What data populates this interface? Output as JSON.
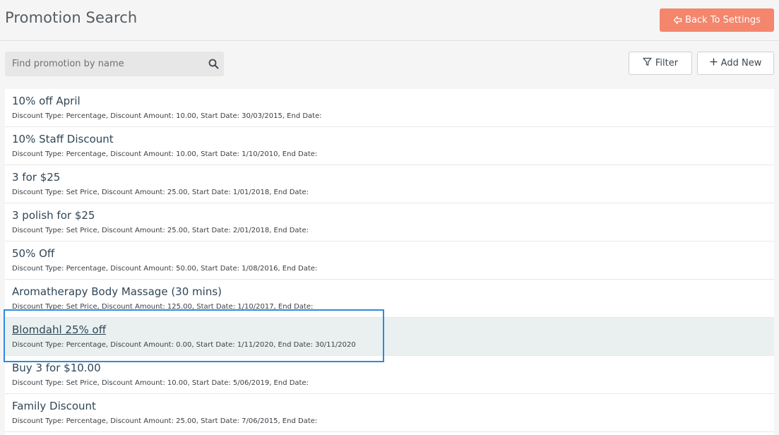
{
  "header": {
    "title": "Promotion Search",
    "back_label": "Back To Settings"
  },
  "toolbar": {
    "search_placeholder": "Find promotion by name",
    "search_value": "",
    "filter_label": "Filter",
    "add_label": "Add New"
  },
  "promotions": [
    {
      "name": "10% off April",
      "details": "Discount Type: Percentage, Discount Amount: 10.00, Start Date: 30/03/2015, End Date:"
    },
    {
      "name": "10% Staff Discount",
      "details": "Discount Type: Percentage, Discount Amount: 10.00, Start Date: 1/10/2010, End Date:"
    },
    {
      "name": "3 for $25",
      "details": "Discount Type: Set Price, Discount Amount: 25.00, Start Date: 1/01/2018, End Date:"
    },
    {
      "name": "3 polish for $25",
      "details": "Discount Type: Set Price, Discount Amount: 25.00, Start Date: 2/01/2018, End Date:"
    },
    {
      "name": "50% Off",
      "details": "Discount Type: Percentage, Discount Amount: 50.00, Start Date: 1/08/2016, End Date:"
    },
    {
      "name": "Aromatherapy Body Massage (30 mins)",
      "details": "Discount Type: Set Price, Discount Amount: 125.00, Start Date: 1/10/2017, End Date:"
    },
    {
      "name": "Blomdahl 25% off",
      "details": "Discount Type: Percentage, Discount Amount: 0.00, Start Date: 1/11/2020, End Date: 30/11/2020"
    },
    {
      "name": "Buy 3 for $10.00",
      "details": "Discount Type: Set Price, Discount Amount: 10.00, Start Date: 5/06/2019, End Date:"
    },
    {
      "name": "Family Discount",
      "details": "Discount Type: Percentage, Discount Amount: 25.00, Start Date: 7/06/2015, End Date:"
    }
  ],
  "selected_index": 6,
  "colors": {
    "accent": "#f3866d",
    "highlight": "#2f8ae0",
    "selected_row": "#eaf0ef"
  },
  "icons": {
    "back": "arrow-left-icon",
    "search": "search-icon",
    "filter": "filter-icon",
    "add": "plus-icon"
  }
}
